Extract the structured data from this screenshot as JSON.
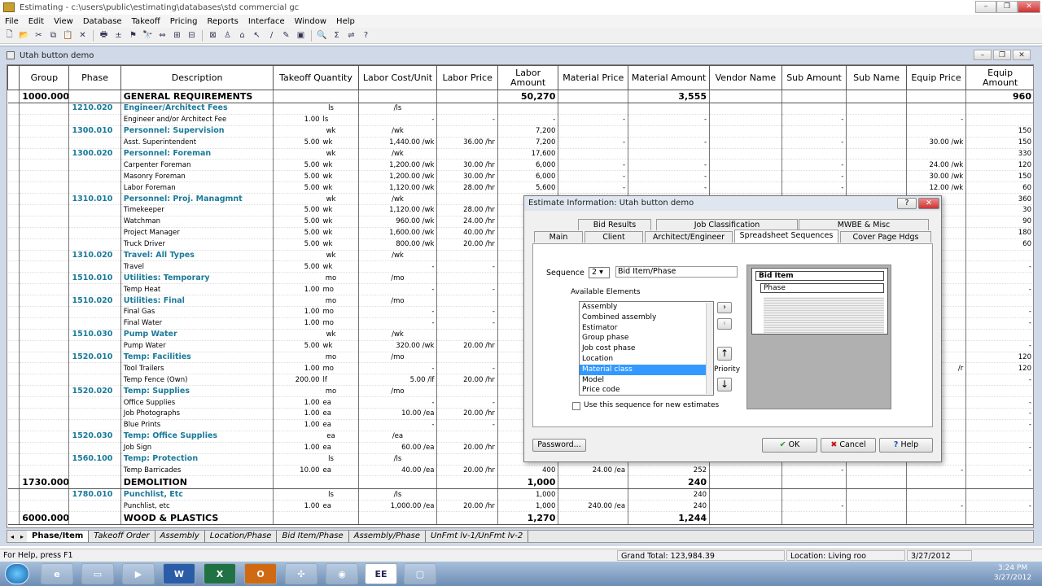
{
  "window": {
    "title": "Estimating - c:\\users\\public\\estimating\\databases\\std commercial gc",
    "minimize": "–",
    "maximize": "❐",
    "close": "✕"
  },
  "menu": [
    "File",
    "Edit",
    "View",
    "Database",
    "Takeoff",
    "Pricing",
    "Reports",
    "Interface",
    "Window",
    "Help"
  ],
  "toolbar": [
    "🗋",
    "📂",
    "✂",
    "⧉",
    "📋",
    "✕",
    "🖶",
    "±",
    "⚑",
    "🔭",
    "⇔",
    "⊞",
    "⊟",
    "⊠",
    "♙",
    "⌂",
    "↖",
    "/",
    "✎",
    "▣",
    "🔍",
    "Σ",
    "⇌",
    "?"
  ],
  "doc": {
    "title": "Utah button demo"
  },
  "columns": [
    "Group",
    "Phase",
    "Description",
    "Takeoff Quantity",
    "Labor Cost/Unit",
    "Labor Price",
    "Labor Amount",
    "Material Price",
    "Material Amount",
    "Vendor Name",
    "Sub Amount",
    "Sub Name",
    "Equip Price",
    "Equip Amount"
  ],
  "rows": [
    {
      "t": "g1",
      "grp": "1000.000",
      "ds": "GENERAL REQUIREMENTS",
      "la": "50,270",
      "ma": "3,555",
      "ea": "960"
    },
    {
      "t": "g2",
      "ph": "1210.020",
      "ds": "Engineer/Architect Fees",
      "u": "ls",
      "lc": "/ls"
    },
    {
      "t": "i",
      "ds": "Engineer and/or Architect Fee",
      "q": "1.00",
      "u": "ls",
      "lc": "-",
      "lp": "-",
      "la": "-",
      "mp": "-",
      "ma": "-",
      "sa": "-",
      "ep": "-"
    },
    {
      "t": "g2",
      "ph": "1300.010",
      "ds": "Personnel: Supervision",
      "u": "wk",
      "lc": "/wk",
      "la": "7,200",
      "ea": "150"
    },
    {
      "t": "i",
      "ds": "Asst. Superintendent",
      "q": "5.00",
      "u": "wk",
      "lc": "1,440.00 /wk",
      "lp": "36.00 /hr",
      "la": "7,200",
      "mp": "-",
      "ma": "-",
      "sa": "-",
      "ep": "30.00 /wk",
      "ea": "150"
    },
    {
      "t": "g2",
      "ph": "1300.020",
      "ds": "Personnel: Foreman",
      "u": "wk",
      "lc": "/wk",
      "la": "17,600",
      "ea": "330"
    },
    {
      "t": "i",
      "ds": "Carpenter Foreman",
      "q": "5.00",
      "u": "wk",
      "lc": "1,200.00 /wk",
      "lp": "30.00 /hr",
      "la": "6,000",
      "mp": "-",
      "ma": "-",
      "sa": "-",
      "ep": "24.00 /wk",
      "ea": "120"
    },
    {
      "t": "i",
      "ds": "Masonry Foreman",
      "q": "5.00",
      "u": "wk",
      "lc": "1,200.00 /wk",
      "lp": "30.00 /hr",
      "la": "6,000",
      "mp": "-",
      "ma": "-",
      "sa": "-",
      "ep": "30.00 /wk",
      "ea": "150"
    },
    {
      "t": "i",
      "ds": "Labor Foreman",
      "q": "5.00",
      "u": "wk",
      "lc": "1,120.00 /wk",
      "lp": "28.00 /hr",
      "la": "5,600",
      "mp": "-",
      "ma": "-",
      "sa": "-",
      "ep": "12.00 /wk",
      "ea": "60"
    },
    {
      "t": "g2",
      "ph": "1310.010",
      "ds": "Personnel: Proj. Managmnt",
      "u": "wk",
      "lc": "/wk",
      "ea": "360"
    },
    {
      "t": "i",
      "ds": "Timekeeper",
      "q": "5.00",
      "u": "wk",
      "lc": "1,120.00 /wk",
      "lp": "28.00 /hr",
      "ea": "30"
    },
    {
      "t": "i",
      "ds": "Watchman",
      "q": "5.00",
      "u": "wk",
      "lc": "960.00 /wk",
      "lp": "24.00 /hr",
      "ea": "90"
    },
    {
      "t": "i",
      "ds": "Project Manager",
      "q": "5.00",
      "u": "wk",
      "lc": "1,600.00 /wk",
      "lp": "40.00 /hr",
      "ea": "180"
    },
    {
      "t": "i",
      "ds": "Truck Driver",
      "q": "5.00",
      "u": "wk",
      "lc": "800.00 /wk",
      "lp": "20.00 /hr",
      "ea": "60"
    },
    {
      "t": "g2",
      "ph": "1310.020",
      "ds": "Travel: All Types",
      "u": "wk",
      "lc": "/wk"
    },
    {
      "t": "i",
      "ds": "Travel",
      "q": "5.00",
      "u": "wk",
      "lc": "-",
      "lp": "-",
      "ea": "-"
    },
    {
      "t": "g2",
      "ph": "1510.010",
      "ds": "Utilities: Temporary",
      "u": "mo",
      "lc": "/mo"
    },
    {
      "t": "i",
      "ds": "Temp Heat",
      "q": "1.00",
      "u": "mo",
      "lc": "-",
      "lp": "-",
      "ea": "-"
    },
    {
      "t": "g2",
      "ph": "1510.020",
      "ds": "Utilities: Final",
      "u": "mo",
      "lc": "/mo"
    },
    {
      "t": "i",
      "ds": "Final Gas",
      "q": "1.00",
      "u": "mo",
      "lc": "-",
      "lp": "-",
      "ea": "-"
    },
    {
      "t": "i",
      "ds": "Final Water",
      "q": "1.00",
      "u": "mo",
      "lc": "-",
      "lp": "-",
      "ea": "-"
    },
    {
      "t": "g2",
      "ph": "1510.030",
      "ds": "Pump Water",
      "u": "wk",
      "lc": "/wk"
    },
    {
      "t": "i",
      "ds": "Pump Water",
      "q": "5.00",
      "u": "wk",
      "lc": "320.00 /wk",
      "lp": "20.00 /hr",
      "ea": "-"
    },
    {
      "t": "g2",
      "ph": "1520.010",
      "ds": "Temp: Facilities",
      "u": "mo",
      "lc": "/mo",
      "ea": "120"
    },
    {
      "t": "i",
      "ds": "Tool Trailers",
      "q": "1.00",
      "u": "mo",
      "lc": "-",
      "lp": "-",
      "ep": "/r",
      "ea": "120"
    },
    {
      "t": "i",
      "ds": "Temp Fence (Own)",
      "q": "200.00",
      "u": "lf",
      "lc": "5.00 /lf",
      "lp": "20.00 /hr",
      "ea": "-"
    },
    {
      "t": "g2",
      "ph": "1520.020",
      "ds": "Temp: Supplies",
      "u": "mo",
      "lc": "/mo"
    },
    {
      "t": "i",
      "ds": "Office Supplies",
      "q": "1.00",
      "u": "ea",
      "lc": "-",
      "lp": "-",
      "ea": "-"
    },
    {
      "t": "i",
      "ds": "Job Photographs",
      "q": "1.00",
      "u": "ea",
      "lc": "10.00 /ea",
      "lp": "20.00 /hr",
      "ea": "-"
    },
    {
      "t": "i",
      "ds": "Blue Prints",
      "q": "1.00",
      "u": "ea",
      "lc": "-",
      "lp": "-",
      "ea": "-"
    },
    {
      "t": "g2",
      "ph": "1520.030",
      "ds": "Temp: Office Supplies",
      "u": "ea",
      "lc": "/ea"
    },
    {
      "t": "i",
      "ds": "Job Sign",
      "q": "1.00",
      "u": "ea",
      "lc": "60.00 /ea",
      "lp": "20.00 /hr",
      "ea": "-"
    },
    {
      "t": "g2",
      "ph": "1560.100",
      "ds": "Temp: Protection",
      "u": "ls",
      "lc": "/ls"
    },
    {
      "t": "i",
      "ds": "Temp Barricades",
      "q": "10.00",
      "u": "ea",
      "lc": "40.00 /ea",
      "lp": "20.00 /hr",
      "la": "400",
      "mp": "24.00 /ea",
      "ma": "252",
      "sa": "-",
      "ep": "-",
      "ea": "-"
    },
    {
      "t": "g1",
      "grp": "1730.000",
      "ds": "DEMOLITION",
      "la": "1,000",
      "ma": "240"
    },
    {
      "t": "g2",
      "ph": "1780.010",
      "ds": "Punchlist, Etc",
      "u": "ls",
      "lc": "/ls",
      "la": "1,000",
      "ma": "240"
    },
    {
      "t": "i",
      "ds": "Punchlist, etc",
      "q": "1.00",
      "u": "ea",
      "lc": "1,000.00 /ea",
      "lp": "20.00 /hr",
      "la": "1,000",
      "mp": "240.00 /ea",
      "ma": "240",
      "sa": "-",
      "ep": "-",
      "ea": "-"
    },
    {
      "t": "g1",
      "grp": "6000.000",
      "ds": "WOOD & PLASTICS",
      "la": "1,270",
      "ma": "1,244"
    }
  ],
  "sheet_tabs": [
    "Phase/Item",
    "Takeoff Order",
    "Assembly",
    "Location/Phase",
    "Bid Item/Phase",
    "Assembly/Phase",
    "UnFmt lv-1/UnFmt lv-2"
  ],
  "status": {
    "help": "For Help, press F1",
    "total": "Grand Total: 123,984.39",
    "location": "Location:  Living roo",
    "date": "3/27/2012"
  },
  "clock": {
    "time": "3:24 PM",
    "date": "3/27/2012"
  },
  "taskbar": [
    "W",
    "X",
    "O",
    "EE"
  ],
  "dialog": {
    "title": "Estimate Information: Utah button demo",
    "tabs_back": [
      "Bid Results",
      "Job Classification",
      "MWBE & Misc"
    ],
    "tabs_front": [
      "Main",
      "Client",
      "Architect/Engineer",
      "Spreadsheet Sequences",
      "Cover Page Hdgs"
    ],
    "sequence_label": "Sequence",
    "sequence_value": "2",
    "sequence_name": "Bid Item/Phase",
    "available_label": "Available Elements",
    "elements": [
      "Assembly",
      "Combined assembly",
      "Estimator",
      "Group phase",
      "Job cost phase",
      "Location",
      "Material class",
      "Model",
      "Price code"
    ],
    "selected_index": 6,
    "priority_label": "Priority",
    "checkbox_label": "Use this sequence for new estimates",
    "preview": [
      "Bid Item",
      "Phase"
    ],
    "password": "Password...",
    "ok": "OK",
    "cancel": "Cancel",
    "help": "Help"
  }
}
